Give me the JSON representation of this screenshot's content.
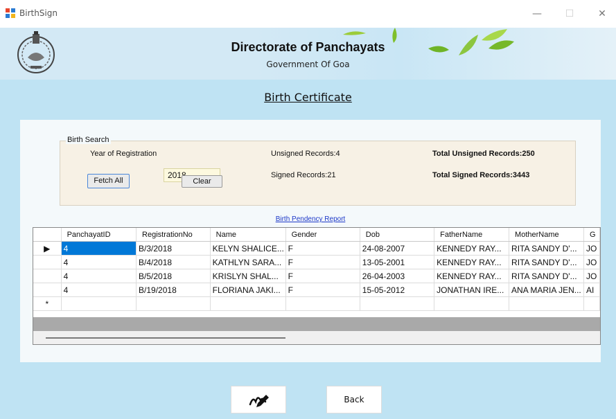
{
  "window": {
    "title": "BirthSign",
    "minimize_label": "—",
    "maximize_label": "☐",
    "close_label": "✕"
  },
  "banner": {
    "title": "Directorate of Panchayats",
    "subtitle": "Government Of Goa"
  },
  "page_heading": "Birth Certificate",
  "search": {
    "group_label": "Birth Search",
    "year_label": "Year of Registration",
    "year_value": "2018",
    "unsigned_records": "Unsigned Records:4",
    "signed_records": "Signed Records:21",
    "total_unsigned": "Total Unsigned Records:250",
    "total_signed": "Total Signed Records:3443",
    "fetch_all_label": "Fetch All",
    "clear_label": "Clear"
  },
  "report_link": "Birth Pendency Report",
  "grid": {
    "columns": [
      "PanchayatID",
      "RegistrationNo",
      "Name",
      "Gender",
      "Dob",
      "FatherName",
      "MotherName",
      "G"
    ],
    "rows": [
      [
        "4",
        "B/3/2018",
        "KELYN SHALICE...",
        "F",
        "24-08-2007",
        "KENNEDY RAY...",
        "RITA SANDY D'...",
        "JO"
      ],
      [
        "4",
        "B/4/2018",
        "KATHLYN SARA...",
        "F",
        "13-05-2001",
        "KENNEDY RAY...",
        "RITA SANDY D'...",
        "JO"
      ],
      [
        "4",
        "B/5/2018",
        "KRISLYN SHAL...",
        "F",
        "26-04-2003",
        "KENNEDY RAY...",
        "RITA SANDY D'...",
        "JO"
      ],
      [
        "4",
        "B/19/2018",
        "FLORIANA JAKI...",
        "F",
        "15-05-2012",
        "JONATHAN IRE...",
        "ANA MARIA JEN...",
        "AI"
      ]
    ],
    "current_row_marker": "▶",
    "new_row_marker": "*"
  },
  "buttons": {
    "sign_icon": "signature-pen-icon",
    "back_label": "Back"
  },
  "colors": {
    "content_bg": "#bfe3f3",
    "selection": "#0078d7",
    "link": "#1c38c8"
  }
}
